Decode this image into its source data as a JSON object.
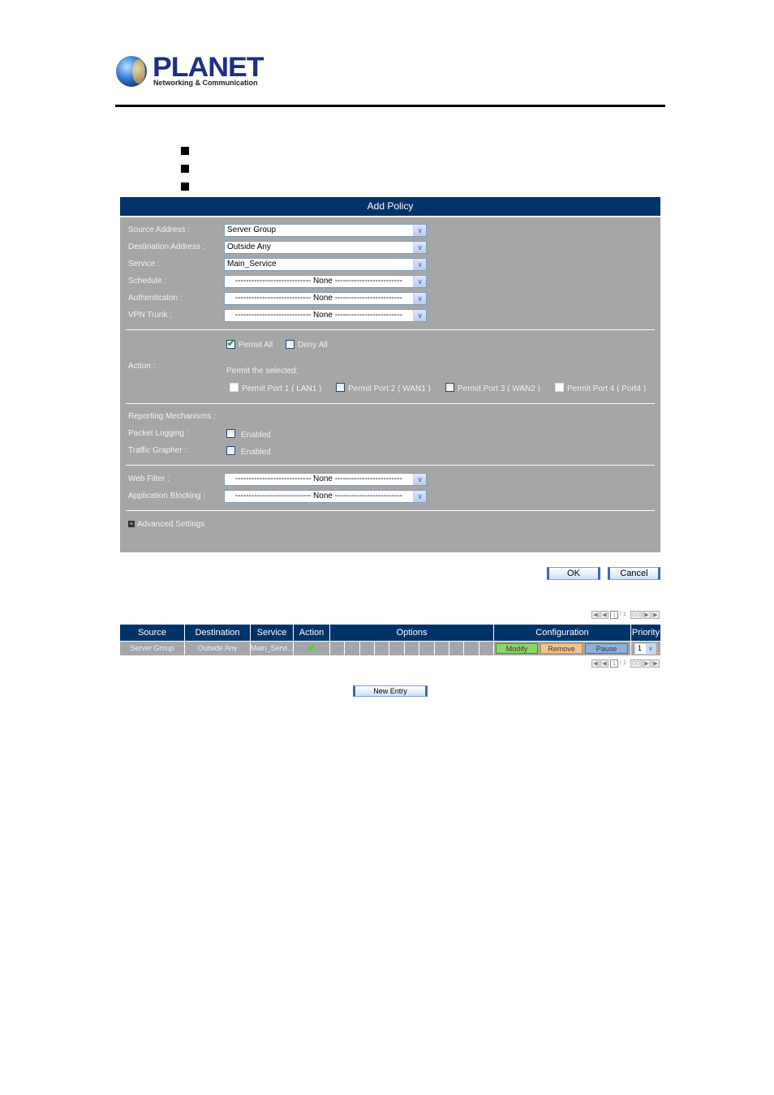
{
  "logo": {
    "brand": "PLANET",
    "tagline": "Networking & Communication"
  },
  "bullets": [
    "",
    "",
    ""
  ],
  "panel": {
    "title": "Add Policy",
    "fields": [
      {
        "label": "Source Address :",
        "value": "Server Group"
      },
      {
        "label": "Destination Address :",
        "value": "Outside Any"
      },
      {
        "label": "Service :",
        "value": "Main_Service"
      },
      {
        "label": "Schedule :",
        "value": "---------------------------- None -------------------------"
      },
      {
        "label": "Authenticaton :",
        "value": "---------------------------- None -------------------------"
      },
      {
        "label": "VPN Trunk :",
        "value": "---------------------------- None -------------------------"
      }
    ],
    "action": {
      "label": "Action :",
      "permit_all": {
        "label": "Permit All",
        "checked": true
      },
      "deny_all": {
        "label": "Deny All",
        "checked": false
      },
      "permit_selected_label": "Permit the selected:",
      "ports": [
        {
          "label": "Permit Port  1  ( LAN1 )",
          "checked": false
        },
        {
          "label": "Permit Port  2  ( WAN1 )",
          "checked": false
        },
        {
          "label": "Permit Port  3  ( WAN2 )",
          "checked": false
        },
        {
          "label": "Permit Port  4  ( Port4 )",
          "checked": false
        }
      ]
    },
    "reporting": {
      "label": "Reporting Mechanisms :",
      "packet_logging": {
        "label": "Packet Logging :",
        "option": "Enabled",
        "checked": false
      },
      "traffic_grapher": {
        "label": "Traffic Grapher :",
        "option": "Enabled",
        "checked": false
      }
    },
    "web_filter": {
      "label": "Web Filter :",
      "value": "---------------------------- None -------------------------"
    },
    "app_blocking": {
      "label": "Application Blocking :",
      "value": "---------------------------- None -------------------------"
    },
    "advanced": "Advanced Settings"
  },
  "buttons": {
    "ok": "OK",
    "cancel": "Cancel",
    "new_entry": "New Entry"
  },
  "pager": {
    "page": "1",
    "total": "/ 1",
    "go": "GO"
  },
  "table": {
    "headers": [
      "Source",
      "Destination",
      "Service",
      "Action",
      "Options",
      "Configuration",
      "Priority"
    ],
    "rows": [
      {
        "source": "Server Group",
        "destination": "Outside Any",
        "service": "Main_Servi...",
        "action": "permit",
        "modify": "Modify",
        "remove": "Remove",
        "pause": "Pause",
        "priority": "1"
      }
    ]
  },
  "colors": {
    "header_bg": "#00336a",
    "panel_bg": "#a6a6a6",
    "modify": "#8fd46a",
    "remove": "#f5c48d",
    "pause": "#8fb0dc"
  }
}
